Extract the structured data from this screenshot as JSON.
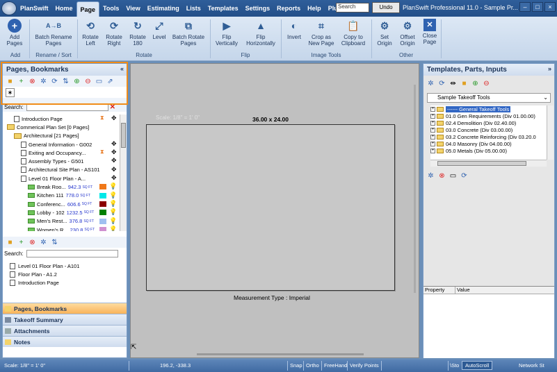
{
  "app": {
    "name": "PlanSwift",
    "window_title": "PlanSwift Professional 11.0 - Sample Pr...",
    "search_placeholder": "Search",
    "undo_label": "Undo",
    "controls": [
      "–",
      "□",
      "×"
    ]
  },
  "menu": [
    "PlanSwift",
    "Home",
    "Page",
    "Tools",
    "View",
    "Estimating",
    "Lists",
    "Templates",
    "Settings",
    "Reports",
    "Help",
    "Plugins"
  ],
  "menu_active": "Page",
  "ribbon": {
    "buttons": [
      {
        "label": "Add Pages",
        "icon": "plus-circle-icon",
        "glyph": "+"
      },
      {
        "label": "Batch Rename Pages",
        "icon": "rename-icon",
        "glyph": "A→B"
      },
      {
        "label": "Rotate Left",
        "icon": "rotate-left-icon",
        "glyph": "⟲"
      },
      {
        "label": "Rotate Right",
        "icon": "rotate-right-icon",
        "glyph": "⟳"
      },
      {
        "label": "Rotate 180",
        "icon": "rotate-180-icon",
        "glyph": "↻"
      },
      {
        "label": "Level",
        "icon": "level-icon",
        "glyph": "⤢"
      },
      {
        "label": "Batch Rotate Pages",
        "icon": "batch-rotate-icon",
        "glyph": "⧉"
      },
      {
        "label": "Flip Vertically",
        "icon": "flip-vertical-icon",
        "glyph": "▶"
      },
      {
        "label": "Flip Horizontally",
        "icon": "flip-horizontal-icon",
        "glyph": "▲"
      },
      {
        "label": "Invert",
        "icon": "invert-icon",
        "glyph": "◐"
      },
      {
        "label": "Crop as New Page",
        "icon": "crop-icon",
        "glyph": "⌗"
      },
      {
        "label": "Copy to Clipboard",
        "icon": "clipboard-icon",
        "glyph": "📋"
      },
      {
        "label": "Set Origin",
        "icon": "set-origin-icon",
        "glyph": "⚙"
      },
      {
        "label": "Offset Origin",
        "icon": "offset-origin-icon",
        "glyph": "⚙"
      },
      {
        "label": "Close Page",
        "icon": "close-page-icon",
        "glyph": "✕"
      }
    ],
    "groups": [
      "Add",
      "Rename / Sort",
      "Rotate",
      "Flip",
      "Image Tools",
      "Other"
    ]
  },
  "left_panel": {
    "title": "Pages, Bookmarks",
    "search_label": "Search:",
    "tree": [
      {
        "label": "Introduction Page",
        "kind": "page",
        "level": 1
      },
      {
        "label": "Commerical Plan Set [0 Pages]",
        "kind": "folder",
        "level": 0
      },
      {
        "label": "Architectural [21 Pages]",
        "kind": "folder",
        "level": 1
      },
      {
        "label": "General Information - G002",
        "kind": "page",
        "level": 2
      },
      {
        "label": "Exiting and Occupancy...",
        "kind": "page",
        "level": 2
      },
      {
        "label": "Assembly Types - G501",
        "kind": "page",
        "level": 2
      },
      {
        "label": "Architectural Site Plan - AS101",
        "kind": "page",
        "level": 2
      },
      {
        "label": "Level 01 Floor Plan - A...",
        "kind": "page",
        "level": 2
      },
      {
        "label": "Break Roo...",
        "kind": "area",
        "level": 3,
        "value": "942.3",
        "unit": "SQ FT",
        "color": "#f07818"
      },
      {
        "label": "Kitchen 111",
        "kind": "area",
        "level": 3,
        "value": "778.0",
        "unit": "SQ FT",
        "color": "#00e8e8"
      },
      {
        "label": "Conferenc...",
        "kind": "area",
        "level": 3,
        "value": "606.6",
        "unit": "SQ FT",
        "color": "#8b0000"
      },
      {
        "label": "Lobby - 102",
        "kind": "area",
        "level": 3,
        "value": "1232.5",
        "unit": "SQ FT",
        "color": "#008000"
      },
      {
        "label": "Men's Rest...",
        "kind": "area",
        "level": 3,
        "value": "376.8",
        "unit": "SQ FT",
        "color": "#a0c0f0"
      },
      {
        "label": "Women's R...",
        "kind": "area",
        "level": 3,
        "value": "230.8",
        "unit": "SQ FT",
        "color": "#d090d0"
      },
      {
        "label": "Manufac...",
        "kind": "area",
        "level": 3,
        "value": "30985.5",
        "unit": "SQ FT",
        "color": "#a0e0a0"
      }
    ],
    "bookmarks_search_label": "Search:",
    "bookmarks": [
      "Level 01 Floor Plan - A101",
      "Floor Plan - A1.2",
      "Introduction Page"
    ],
    "nav_tabs": [
      "Pages, Bookmarks",
      "Takeoff Summary",
      "Attachments",
      "Notes"
    ]
  },
  "canvas": {
    "scale_ghost": "Scale: 1/8\" = 1' 0\"",
    "sheet_size": "36.00 x 24.00",
    "measurement_type": "Measurement Type : Imperial"
  },
  "right_panel": {
    "title": "Templates, Parts, Inputs",
    "selected_template": "Sample Takeoff Tools",
    "templates": [
      {
        "label": "------ General Takeoff Tools",
        "selected": true
      },
      {
        "label": "01.0  Gen Requirements (Div 01.00.00)"
      },
      {
        "label": "02.4  Demolition (Div 02.40.00)"
      },
      {
        "label": "03.0  Concrete (Div 03.00.00)"
      },
      {
        "label": "03.2  Concrete Reinforcing (Div 03.20.0"
      },
      {
        "label": "04.0  Masonry (Div 04.00.00)"
      },
      {
        "label": "05.0  Metals (Div 05.00.00)"
      }
    ],
    "property_col": "Property",
    "value_col": "Value"
  },
  "status": {
    "scale": "Scale: 1/8\" = 1' 0\"",
    "coords": "196.2, -338.3",
    "snap": "Snap",
    "ortho": "Ortho",
    "freehand": "FreeHand",
    "verify": "Verify Points",
    "sto": "\\Sto",
    "autoscroll": "AutoScroll",
    "network": "Network St"
  }
}
